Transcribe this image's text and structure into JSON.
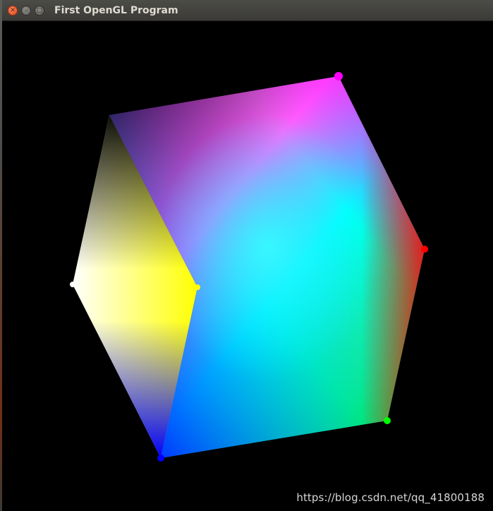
{
  "window": {
    "title": "First OpenGL Program",
    "buttons": {
      "close_glyph": "✕",
      "minimize_glyph": "–",
      "maximize_glyph": "□"
    }
  },
  "scene": {
    "object": "rgb-color-cube",
    "background_color": "#000000",
    "vertex_colors": {
      "white": "#ffffff",
      "yellow": "#ffff00",
      "magenta": "#ff00ff",
      "red": "#ff0000",
      "green": "#00ff00",
      "blue": "#0000ff",
      "cyan": "#00ffff",
      "black": "#000000"
    }
  },
  "overlay": {
    "watermark": "https://blog.csdn.net/qq_41800188"
  }
}
